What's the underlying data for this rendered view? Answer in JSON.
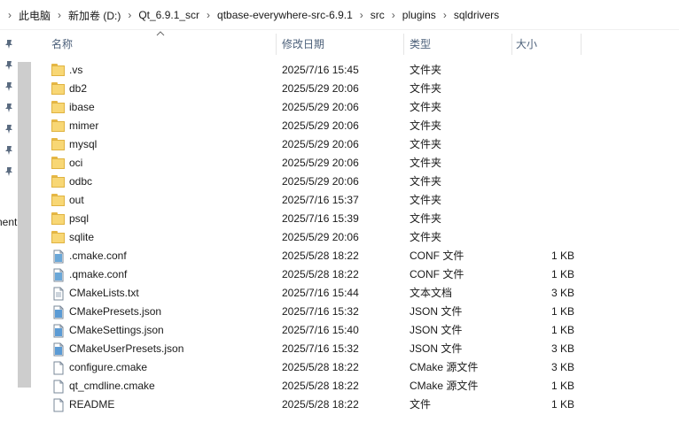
{
  "breadcrumb": [
    "此电脑",
    "新加卷 (D:)",
    "Qt_6.9.1_scr",
    "qtbase-everywhere-src-6.9.1",
    "src",
    "plugins",
    "sqldrivers"
  ],
  "leftpane": {
    "partial_label": "nent"
  },
  "columns": {
    "name": "名称",
    "date": "修改日期",
    "type": "类型",
    "size": "大小"
  },
  "files": [
    {
      "icon": "folder-icon",
      "name": ".vs",
      "date": "2025/7/16 15:45",
      "type": "文件夹",
      "size": ""
    },
    {
      "icon": "folder-icon",
      "name": "db2",
      "date": "2025/5/29 20:06",
      "type": "文件夹",
      "size": ""
    },
    {
      "icon": "folder-icon",
      "name": "ibase",
      "date": "2025/5/29 20:06",
      "type": "文件夹",
      "size": ""
    },
    {
      "icon": "folder-icon",
      "name": "mimer",
      "date": "2025/5/29 20:06",
      "type": "文件夹",
      "size": ""
    },
    {
      "icon": "folder-icon",
      "name": "mysql",
      "date": "2025/5/29 20:06",
      "type": "文件夹",
      "size": ""
    },
    {
      "icon": "folder-icon",
      "name": "oci",
      "date": "2025/5/29 20:06",
      "type": "文件夹",
      "size": ""
    },
    {
      "icon": "folder-icon",
      "name": "odbc",
      "date": "2025/5/29 20:06",
      "type": "文件夹",
      "size": ""
    },
    {
      "icon": "folder-icon",
      "name": "out",
      "date": "2025/7/16 15:37",
      "type": "文件夹",
      "size": ""
    },
    {
      "icon": "folder-icon",
      "name": "psql",
      "date": "2025/7/16 15:39",
      "type": "文件夹",
      "size": ""
    },
    {
      "icon": "folder-icon",
      "name": "sqlite",
      "date": "2025/5/29 20:06",
      "type": "文件夹",
      "size": ""
    },
    {
      "icon": "conf-file-icon",
      "name": ".cmake.conf",
      "date": "2025/5/28 18:22",
      "type": "CONF 文件",
      "size": "1 KB"
    },
    {
      "icon": "conf-file-icon",
      "name": ".qmake.conf",
      "date": "2025/5/28 18:22",
      "type": "CONF 文件",
      "size": "1 KB"
    },
    {
      "icon": "text-file-icon",
      "name": "CMakeLists.txt",
      "date": "2025/7/16 15:44",
      "type": "文本文档",
      "size": "3 KB"
    },
    {
      "icon": "json-file-icon",
      "name": "CMakePresets.json",
      "date": "2025/7/16 15:32",
      "type": "JSON 文件",
      "size": "1 KB"
    },
    {
      "icon": "json-file-icon",
      "name": "CMakeSettings.json",
      "date": "2025/7/16 15:40",
      "type": "JSON 文件",
      "size": "1 KB"
    },
    {
      "icon": "json-file-icon",
      "name": "CMakeUserPresets.json",
      "date": "2025/7/16 15:32",
      "type": "JSON 文件",
      "size": "3 KB"
    },
    {
      "icon": "blank-file-icon",
      "name": "configure.cmake",
      "date": "2025/5/28 18:22",
      "type": "CMake 源文件",
      "size": "3 KB"
    },
    {
      "icon": "blank-file-icon",
      "name": "qt_cmdline.cmake",
      "date": "2025/5/28 18:22",
      "type": "CMake 源文件",
      "size": "1 KB"
    },
    {
      "icon": "blank-file-icon",
      "name": "README",
      "date": "2025/5/28 18:22",
      "type": "文件",
      "size": "1 KB"
    }
  ]
}
